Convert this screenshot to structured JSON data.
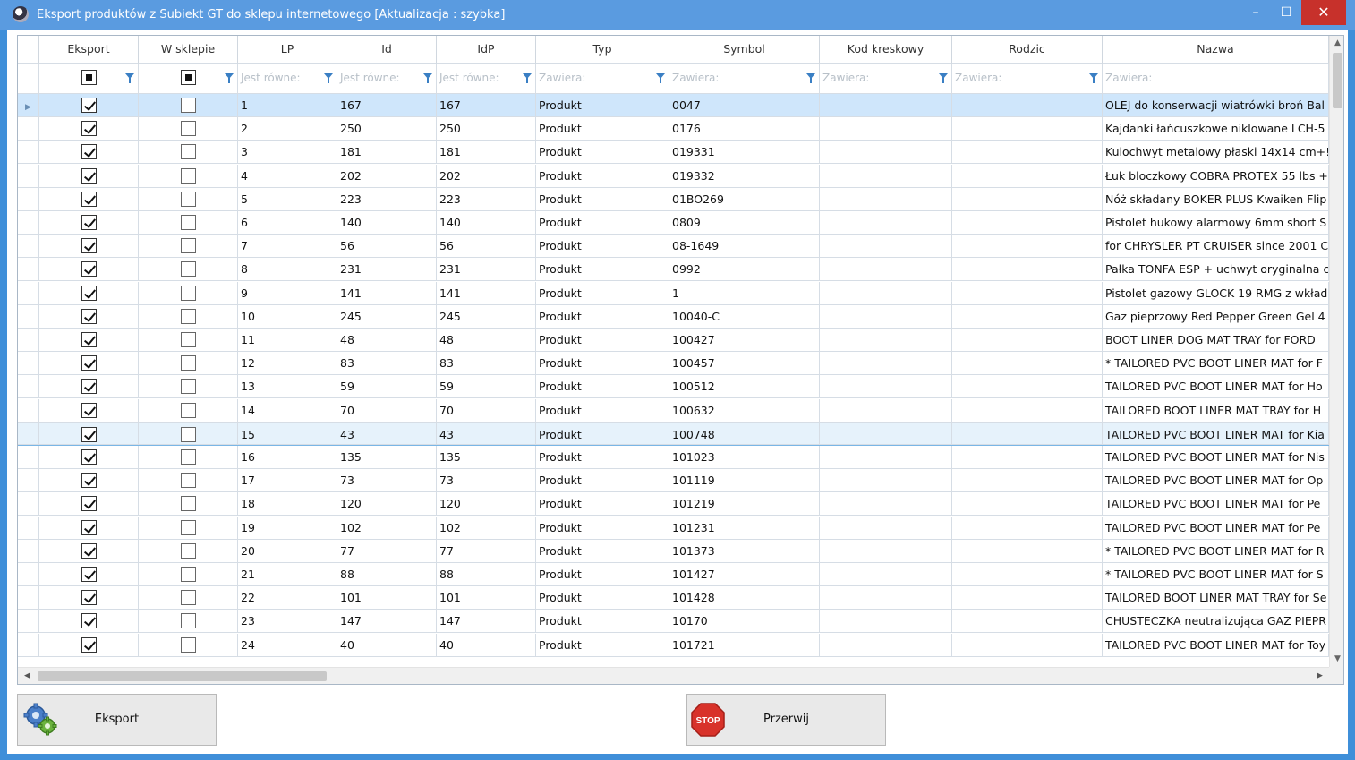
{
  "window": {
    "title": "Eksport produktów z Subiekt GT do sklepu internetowego [Aktualizacja : szybka]",
    "minimize": "–",
    "maximize": "☐",
    "close": "✕"
  },
  "columns": [
    {
      "key": "eksport",
      "label": "Eksport"
    },
    {
      "key": "wsklepie",
      "label": "W sklepie"
    },
    {
      "key": "lp",
      "label": "LP"
    },
    {
      "key": "id",
      "label": "Id"
    },
    {
      "key": "idp",
      "label": "IdP"
    },
    {
      "key": "typ",
      "label": "Typ"
    },
    {
      "key": "symbol",
      "label": "Symbol"
    },
    {
      "key": "kod",
      "label": "Kod kreskowy"
    },
    {
      "key": "rodzic",
      "label": "Rodzic"
    },
    {
      "key": "nazwa",
      "label": "Nazwa"
    }
  ],
  "filters": {
    "lp": "Jest równe:",
    "id": "Jest równe:",
    "idp": "Jest równe:",
    "typ": "Zawiera:",
    "symbol": "Zawiera:",
    "kod": "Zawiera:",
    "rodzic": "Zawiera:",
    "nazwa": "Zawiera:"
  },
  "rows": [
    {
      "lp": "1",
      "id": "167",
      "idp": "167",
      "typ": "Produkt",
      "symbol": "0047",
      "nazwa": "OLEJ do konserwacji wiatrówki broń Bal"
    },
    {
      "lp": "2",
      "id": "250",
      "idp": "250",
      "typ": "Produkt",
      "symbol": "0176",
      "nazwa": "Kajdanki łańcuszkowe niklowane LCH-5"
    },
    {
      "lp": "3",
      "id": "181",
      "idp": "181",
      "typ": "Produkt",
      "symbol": "019331",
      "nazwa": "Kulochwyt metalowy płaski 14x14 cm+!"
    },
    {
      "lp": "4",
      "id": "202",
      "idp": "202",
      "typ": "Produkt",
      "symbol": "019332",
      "nazwa": "Łuk bloczkowy COBRA PROTEX 55 lbs +"
    },
    {
      "lp": "5",
      "id": "223",
      "idp": "223",
      "typ": "Produkt",
      "symbol": "01BO269",
      "nazwa": "Nóż składany BOKER PLUS Kwaiken Flip"
    },
    {
      "lp": "6",
      "id": "140",
      "idp": "140",
      "typ": "Produkt",
      "symbol": "0809",
      "nazwa": "Pistolet hukowy alarmowy 6mm short S"
    },
    {
      "lp": "7",
      "id": "56",
      "idp": "56",
      "typ": "Produkt",
      "symbol": "08-1649",
      "nazwa": "for CHRYSLER PT CRUISER since 2001 C"
    },
    {
      "lp": "8",
      "id": "231",
      "idp": "231",
      "typ": "Produkt",
      "symbol": "0992",
      "nazwa": "Pałka TONFA ESP + uchwyt oryginalna c"
    },
    {
      "lp": "9",
      "id": "141",
      "idp": "141",
      "typ": "Produkt",
      "symbol": "1",
      "nazwa": "Pistolet gazowy GLOCK 19 RMG z wkład"
    },
    {
      "lp": "10",
      "id": "245",
      "idp": "245",
      "typ": "Produkt",
      "symbol": "10040-C",
      "nazwa": "Gaz pieprzowy Red Pepper Green Gel 4"
    },
    {
      "lp": "11",
      "id": "48",
      "idp": "48",
      "typ": "Produkt",
      "symbol": "100427",
      "nazwa": "BOOT LINER DOG MAT TRAY for FORD"
    },
    {
      "lp": "12",
      "id": "83",
      "idp": "83",
      "typ": "Produkt",
      "symbol": "100457",
      "nazwa": "* TAILORED PVC BOOT LINER MAT for F"
    },
    {
      "lp": "13",
      "id": "59",
      "idp": "59",
      "typ": "Produkt",
      "symbol": "100512",
      "nazwa": "TAILORED PVC BOOT LINER MAT for Ho"
    },
    {
      "lp": "14",
      "id": "70",
      "idp": "70",
      "typ": "Produkt",
      "symbol": "100632",
      "nazwa": "TAILORED BOOT LINER MAT TRAY for H"
    },
    {
      "lp": "15",
      "id": "43",
      "idp": "43",
      "typ": "Produkt",
      "symbol": "100748",
      "nazwa": "TAILORED PVC BOOT LINER MAT for Kia"
    },
    {
      "lp": "16",
      "id": "135",
      "idp": "135",
      "typ": "Produkt",
      "symbol": "101023",
      "nazwa": "TAILORED PVC BOOT LINER MAT for Nis"
    },
    {
      "lp": "17",
      "id": "73",
      "idp": "73",
      "typ": "Produkt",
      "symbol": "101119",
      "nazwa": "TAILORED PVC BOOT LINER MAT for Op"
    },
    {
      "lp": "18",
      "id": "120",
      "idp": "120",
      "typ": "Produkt",
      "symbol": "101219",
      "nazwa": "TAILORED PVC BOOT LINER MAT for Pe"
    },
    {
      "lp": "19",
      "id": "102",
      "idp": "102",
      "typ": "Produkt",
      "symbol": "101231",
      "nazwa": "TAILORED PVC BOOT LINER MAT for Pe"
    },
    {
      "lp": "20",
      "id": "77",
      "idp": "77",
      "typ": "Produkt",
      "symbol": "101373",
      "nazwa": "* TAILORED PVC BOOT LINER MAT for R"
    },
    {
      "lp": "21",
      "id": "88",
      "idp": "88",
      "typ": "Produkt",
      "symbol": "101427",
      "nazwa": "* TAILORED PVC BOOT LINER MAT for S"
    },
    {
      "lp": "22",
      "id": "101",
      "idp": "101",
      "typ": "Produkt",
      "symbol": "101428",
      "nazwa": "TAILORED BOOT LINER MAT TRAY for Se"
    },
    {
      "lp": "23",
      "id": "147",
      "idp": "147",
      "typ": "Produkt",
      "symbol": "10170",
      "nazwa": "CHUSTECZKA neutralizująca GAZ PIEPR"
    },
    {
      "lp": "24",
      "id": "40",
      "idp": "40",
      "typ": "Produkt",
      "symbol": "101721",
      "nazwa": "TAILORED PVC BOOT LINER MAT for Toy"
    }
  ],
  "buttons": {
    "export": "Eksport",
    "stop": "Przerwij",
    "stop_icon_text": "STOP"
  },
  "colors": {
    "titlebar": "#5a9be0",
    "close": "#c7312b",
    "selection": "#cfe6fb",
    "filter_icon": "#3a7fc4"
  }
}
